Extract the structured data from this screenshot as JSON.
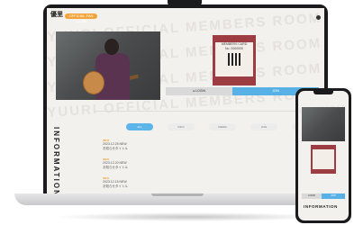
{
  "watermark_line": "YUURI OFFICIAL MEMBERS ROOM YUURI OFFICIAL MEMBERS ROOM",
  "header": {
    "logo_text": "優里",
    "badge_label": "OFFICIAL FAN CLUB"
  },
  "membership_card": {
    "line1": "MEMBERS CARD",
    "line2": "No. 0000000"
  },
  "tabs": {
    "login_label": "● LOGIN",
    "join_label": "JOIN"
  },
  "info_section": {
    "title": "INFORMATION",
    "filters": [
      "ALL",
      "INFO",
      "MEDIA",
      "LIVE",
      "GOODS"
    ],
    "news": [
      {
        "tag": "INFO",
        "date": "2023.12.25 NEW",
        "title": "お知らせタイトル"
      },
      {
        "tag": "INFO",
        "date": "2023.12.20 NEW",
        "title": "お知らせタイトル"
      },
      {
        "tag": "INFO",
        "date": "2023.12.15 NEW",
        "title": "お知らせタイトル"
      }
    ]
  },
  "phone": {
    "login_label": "LOGIN",
    "join_label": "JOIN",
    "info_title": "INFORMATION"
  },
  "colors": {
    "accent_orange": "#f2a43a",
    "accent_blue": "#58b1e6",
    "card_red": "#9d3d43",
    "device_body": "#1b1b1d"
  }
}
